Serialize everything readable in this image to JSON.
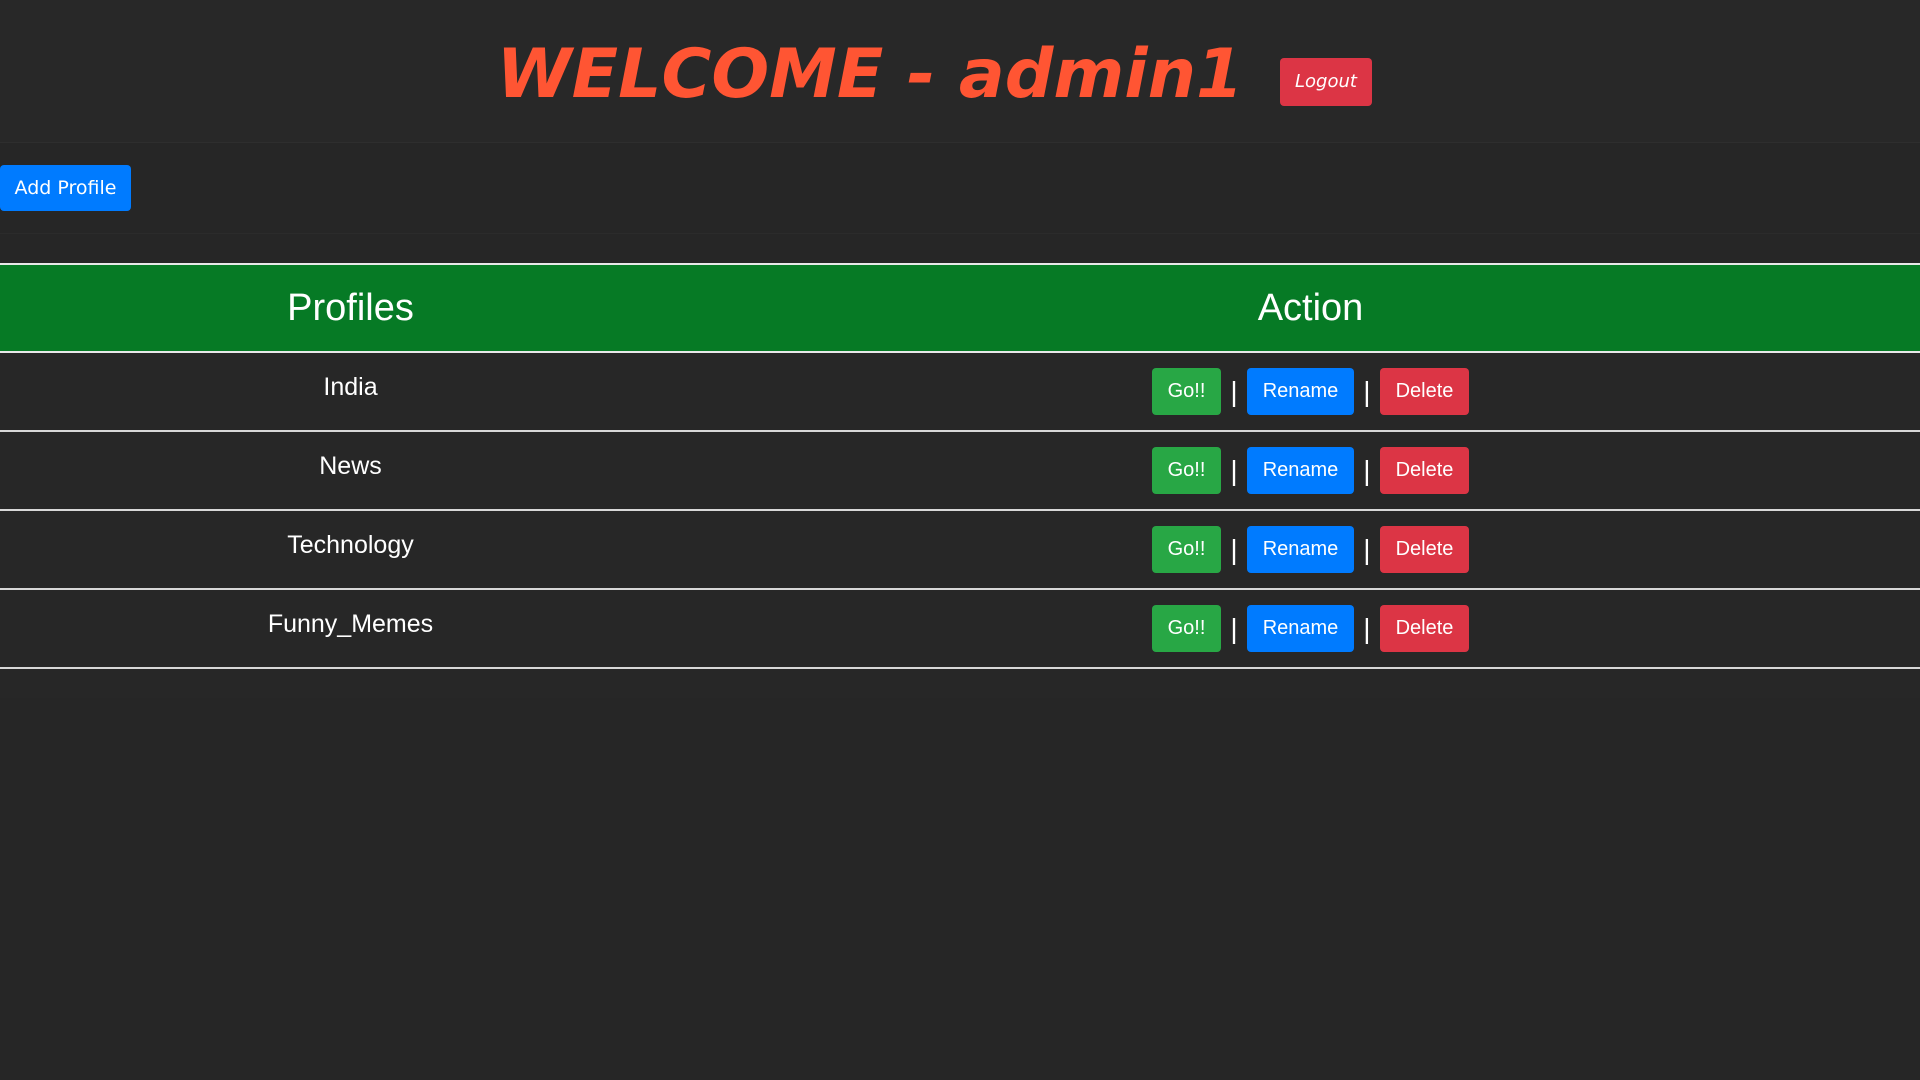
{
  "header": {
    "title": "WELCOME - admin1",
    "logout_label": "Logout"
  },
  "toolbar": {
    "add_profile_label": "Add Profile"
  },
  "table": {
    "columns": [
      "Profiles",
      "Action"
    ],
    "rows": [
      {
        "name": "India",
        "go": "Go!!",
        "sep1": "|",
        "rename": "Rename",
        "sep2": "|",
        "delete": "Delete"
      },
      {
        "name": "News",
        "go": "Go!!",
        "sep1": "|",
        "rename": "Rename",
        "sep2": "|",
        "delete": "Delete"
      },
      {
        "name": "Technology",
        "go": "Go!!",
        "sep1": "|",
        "rename": "Rename",
        "sep2": "|",
        "delete": "Delete"
      },
      {
        "name": "Funny_Memes",
        "go": "Go!!",
        "sep1": "|",
        "rename": "Rename",
        "sep2": "|",
        "delete": "Delete"
      }
    ]
  },
  "colors": {
    "background": "#262626",
    "title": "#ff5533",
    "header_row": "#067a25",
    "primary": "#007bff",
    "success": "#28a745",
    "danger": "#dc3545"
  }
}
